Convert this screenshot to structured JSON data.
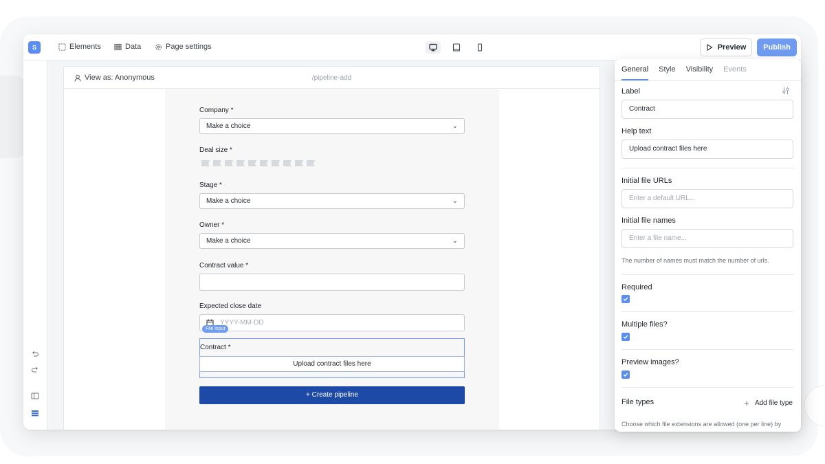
{
  "app": {
    "logo_letter": "S"
  },
  "topbar": {
    "nav": [
      {
        "label": "Elements",
        "icon": "select-icon"
      },
      {
        "label": "Data",
        "icon": "table-icon"
      },
      {
        "label": "Page settings",
        "icon": "gear-icon"
      }
    ],
    "devices": [
      "desktop-icon",
      "tablet-icon",
      "mobile-icon"
    ],
    "preview_label": "Preview",
    "publish_label": "Publish"
  },
  "canvas": {
    "view_as": "View as: Anonymous",
    "slug": "/pipeline-add"
  },
  "form": {
    "company_label": "Company *",
    "company_value": "Make a choice",
    "deal_size_label": "Deal size *",
    "deal_size_flags": 10,
    "stage_label": "Stage *",
    "stage_value": "Make a choice",
    "owner_label": "Owner *",
    "owner_value": "Make a choice",
    "contract_value_label": "Contract value *",
    "contract_value_value": "",
    "close_date_label": "Expected close date",
    "close_date_placeholder": "YYYY-MM-DD",
    "file_tag": "File input",
    "contract_label": "Contract *",
    "contract_upload": "Upload contract files here",
    "create_button": "+ Create pipeline"
  },
  "panel": {
    "tabs": [
      "General",
      "Style",
      "Visibility",
      "Events"
    ],
    "label_title": "Label",
    "label_value": "Contract",
    "help_title": "Help text",
    "help_value": "Upload contract files here",
    "urls_title": "Initial file URLs",
    "urls_placeholder": "Enter a default URL...",
    "names_title": "Initial file names",
    "names_placeholder": "Enter a file name...",
    "names_note": "The number of names must match the number of urls.",
    "required_title": "Required",
    "required_checked": true,
    "multiple_title": "Multiple files?",
    "multiple_checked": true,
    "preview_title": "Preview images?",
    "preview_checked": true,
    "filetypes_title": "File types",
    "add_file_type": "Add file type",
    "filetypes_note": "Choose which file extensions are allowed (one per line) by"
  },
  "colors": {
    "accent": "#5b8def",
    "primary_button": "#1c4aa6",
    "publish": "#6f9cf0"
  }
}
